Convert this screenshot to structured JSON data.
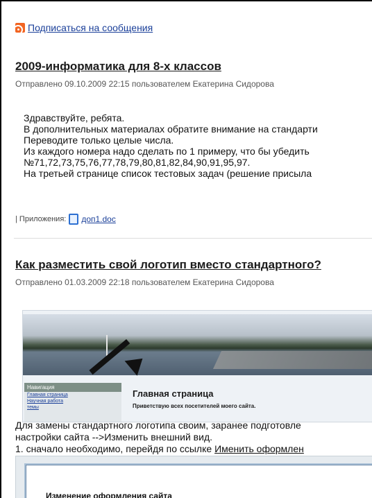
{
  "rss_link": "Подписаться на сообщения",
  "post1": {
    "title": "2009-информатика для 8-х классов",
    "meta": "Отправлено 09.10.2009 22:15 пользователем Екатерина Сидорова",
    "lines": [
      "Здравствуйте, ребята.",
      "В дополнительных материалах обратите внимание на стандарти",
      "Переводите только целые числа.",
      "Из каждого номера надо сделать по 1 примеру, что бы убедить",
      "№71,72,73,75,76,77,78,79,80,81,82,84,90,91,95,97.",
      "На третьей странице список тестовых задач (решение присыла"
    ],
    "attachments_label": "| Приложения:",
    "attachment": "доп1.doc"
  },
  "post2": {
    "title": "Как разместить свой логотип вместо стандартного?",
    "meta": "Отправлено 01.03.2009 22:18 пользователем Екатерина Сидорова",
    "screenshot": {
      "nav_header": "Навигация",
      "nav_items": [
        "Главная страница",
        "Научная работа",
        "темы"
      ],
      "page_heading": "Главная страница",
      "page_subtitle": "Приветствую всех посетителей моего сайта."
    },
    "line1": "Для замены стандартного логотипа своим, заранее подготовле",
    "line2": "настройки сайта -->Изменить внешний вид.",
    "line3_prefix": "1. сначало необходимо, перейдя по ссылке ",
    "line3_link": "Именить оформлен",
    "form_title": "Изменение оформления сайта"
  }
}
